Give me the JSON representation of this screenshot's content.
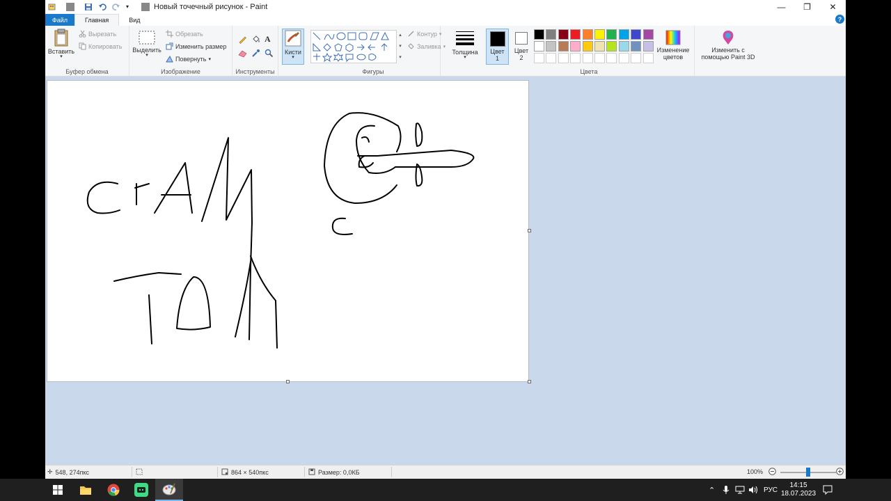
{
  "window": {
    "title": "Новый точечный рисунок - Paint",
    "controls": [
      "—",
      "❐",
      "✕"
    ]
  },
  "tabs": {
    "file": "Файл",
    "home": "Главная",
    "view": "Вид"
  },
  "ribbon": {
    "clipboard": {
      "label": "Буфер обмена",
      "paste": "Вставить",
      "cut": "Вырезать",
      "copy": "Копировать"
    },
    "image": {
      "label": "Изображение",
      "select": "Выделить",
      "crop": "Обрезать",
      "resize": "Изменить размер",
      "rotate": "Повернуть"
    },
    "tools": {
      "label": "Инструменты",
      "text_tool": "A"
    },
    "brushes": {
      "label": "Кисти"
    },
    "shapes": {
      "label": "Фигуры",
      "outline": "Контур",
      "fill": "Заливка"
    },
    "size": {
      "label": "Толщина"
    },
    "colors": {
      "label": "Цвета",
      "color1": "Цвет",
      "color1_num": "1",
      "color2": "Цвет",
      "color2_num": "2",
      "edit_line1": "Изменение",
      "edit_line2": "цветов",
      "palette_row1": [
        "#000000",
        "#7f7f7f",
        "#880015",
        "#ed1c24",
        "#ff7f27",
        "#fff200",
        "#22b14c",
        "#00a2e8",
        "#3f48cc",
        "#a349a4"
      ],
      "palette_row2": [
        "#ffffff",
        "#c3c3c3",
        "#b97a57",
        "#ffaec9",
        "#ffc90e",
        "#efe4b0",
        "#b5e61d",
        "#99d9ea",
        "#7092be",
        "#c8bfe7"
      ]
    },
    "paint3d": {
      "line1": "Изменить с",
      "line2": "помощью Paint 3D"
    }
  },
  "status": {
    "cursor_pos": "548, 274пкс",
    "canvas_size": "864 × 540пкс",
    "file_size": "Размер: 0,0КБ",
    "zoom": "100%",
    "zoom_level": 0.5
  },
  "taskbar": {
    "lang": "РУС",
    "time": "14:15",
    "date": "18.07.2023"
  }
}
